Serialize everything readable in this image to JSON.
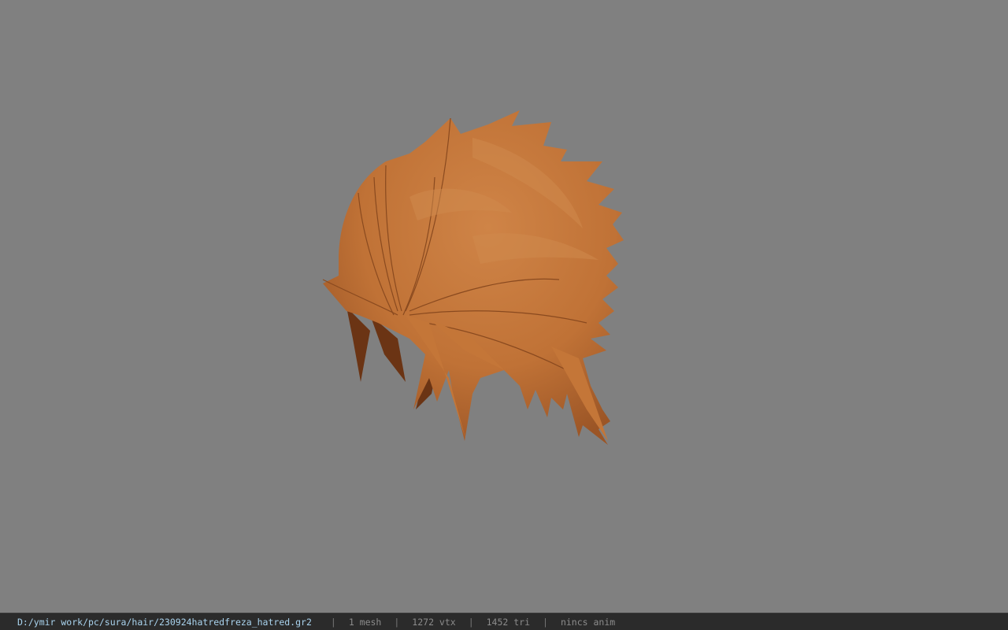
{
  "viewport": {
    "background": "#808080",
    "model": {
      "hair_light": "#c77a3e",
      "hair_mid": "#b96a30",
      "hair_dark": "#6b3414"
    }
  },
  "status": {
    "path": "D:/ymir work/pc/sura/hair/230924hatredfreza_hatred.gr2",
    "separator": "|",
    "meshes": "1 mesh",
    "vertices": "1272 vtx",
    "triangles": "1452 tri",
    "anim": "nincs anim"
  }
}
